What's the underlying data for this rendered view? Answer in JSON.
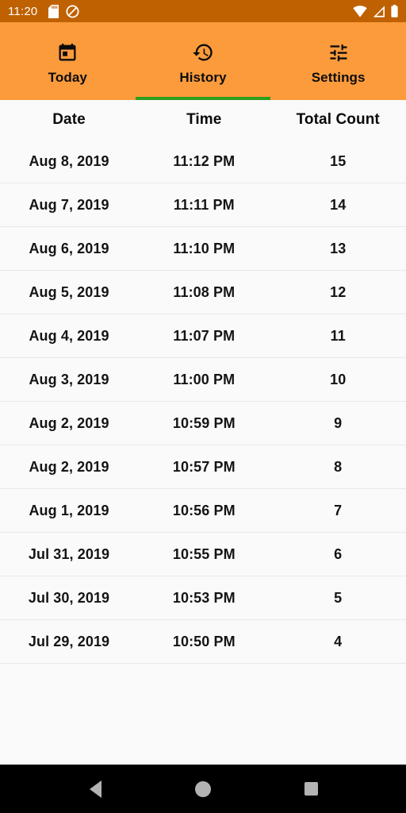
{
  "status_bar": {
    "clock": "11:20",
    "background": "#bf6100",
    "foreground": "#ffffff",
    "left_icons": [
      "sd-card-icon",
      "do-not-disturb-icon"
    ],
    "right_icons": [
      "wifi-icon",
      "cellular-signal-icon",
      "battery-icon"
    ]
  },
  "tabs": {
    "background": "#fb9b3c",
    "indicator_color": "#2e9e1e",
    "active_index": 1,
    "items": [
      {
        "label": "Today",
        "icon": "calendar-today-icon"
      },
      {
        "label": "History",
        "icon": "history-clock-icon"
      },
      {
        "label": "Settings",
        "icon": "tune-sliders-icon"
      }
    ]
  },
  "table": {
    "columns": [
      "Date",
      "Time",
      "Total Count"
    ],
    "rows": [
      {
        "date": "Aug 8, 2019",
        "time": "11:12 PM",
        "count": "15"
      },
      {
        "date": "Aug 7, 2019",
        "time": "11:11 PM",
        "count": "14"
      },
      {
        "date": "Aug 6, 2019",
        "time": "11:10 PM",
        "count": "13"
      },
      {
        "date": "Aug 5, 2019",
        "time": "11:08 PM",
        "count": "12"
      },
      {
        "date": "Aug 4, 2019",
        "time": "11:07 PM",
        "count": "11"
      },
      {
        "date": "Aug 3, 2019",
        "time": "11:00 PM",
        "count": "10"
      },
      {
        "date": "Aug 2, 2019",
        "time": "10:59 PM",
        "count": "9"
      },
      {
        "date": "Aug 2, 2019",
        "time": "10:57 PM",
        "count": "8"
      },
      {
        "date": "Aug 1, 2019",
        "time": "10:56 PM",
        "count": "7"
      },
      {
        "date": "Jul 31, 2019",
        "time": "10:55 PM",
        "count": "6"
      },
      {
        "date": "Jul 30, 2019",
        "time": "10:53 PM",
        "count": "5"
      },
      {
        "date": "Jul 29, 2019",
        "time": "10:50 PM",
        "count": "4"
      }
    ]
  },
  "nav_bar": {
    "background": "#000000",
    "buttons": [
      "back-icon",
      "home-icon",
      "recents-icon"
    ]
  }
}
